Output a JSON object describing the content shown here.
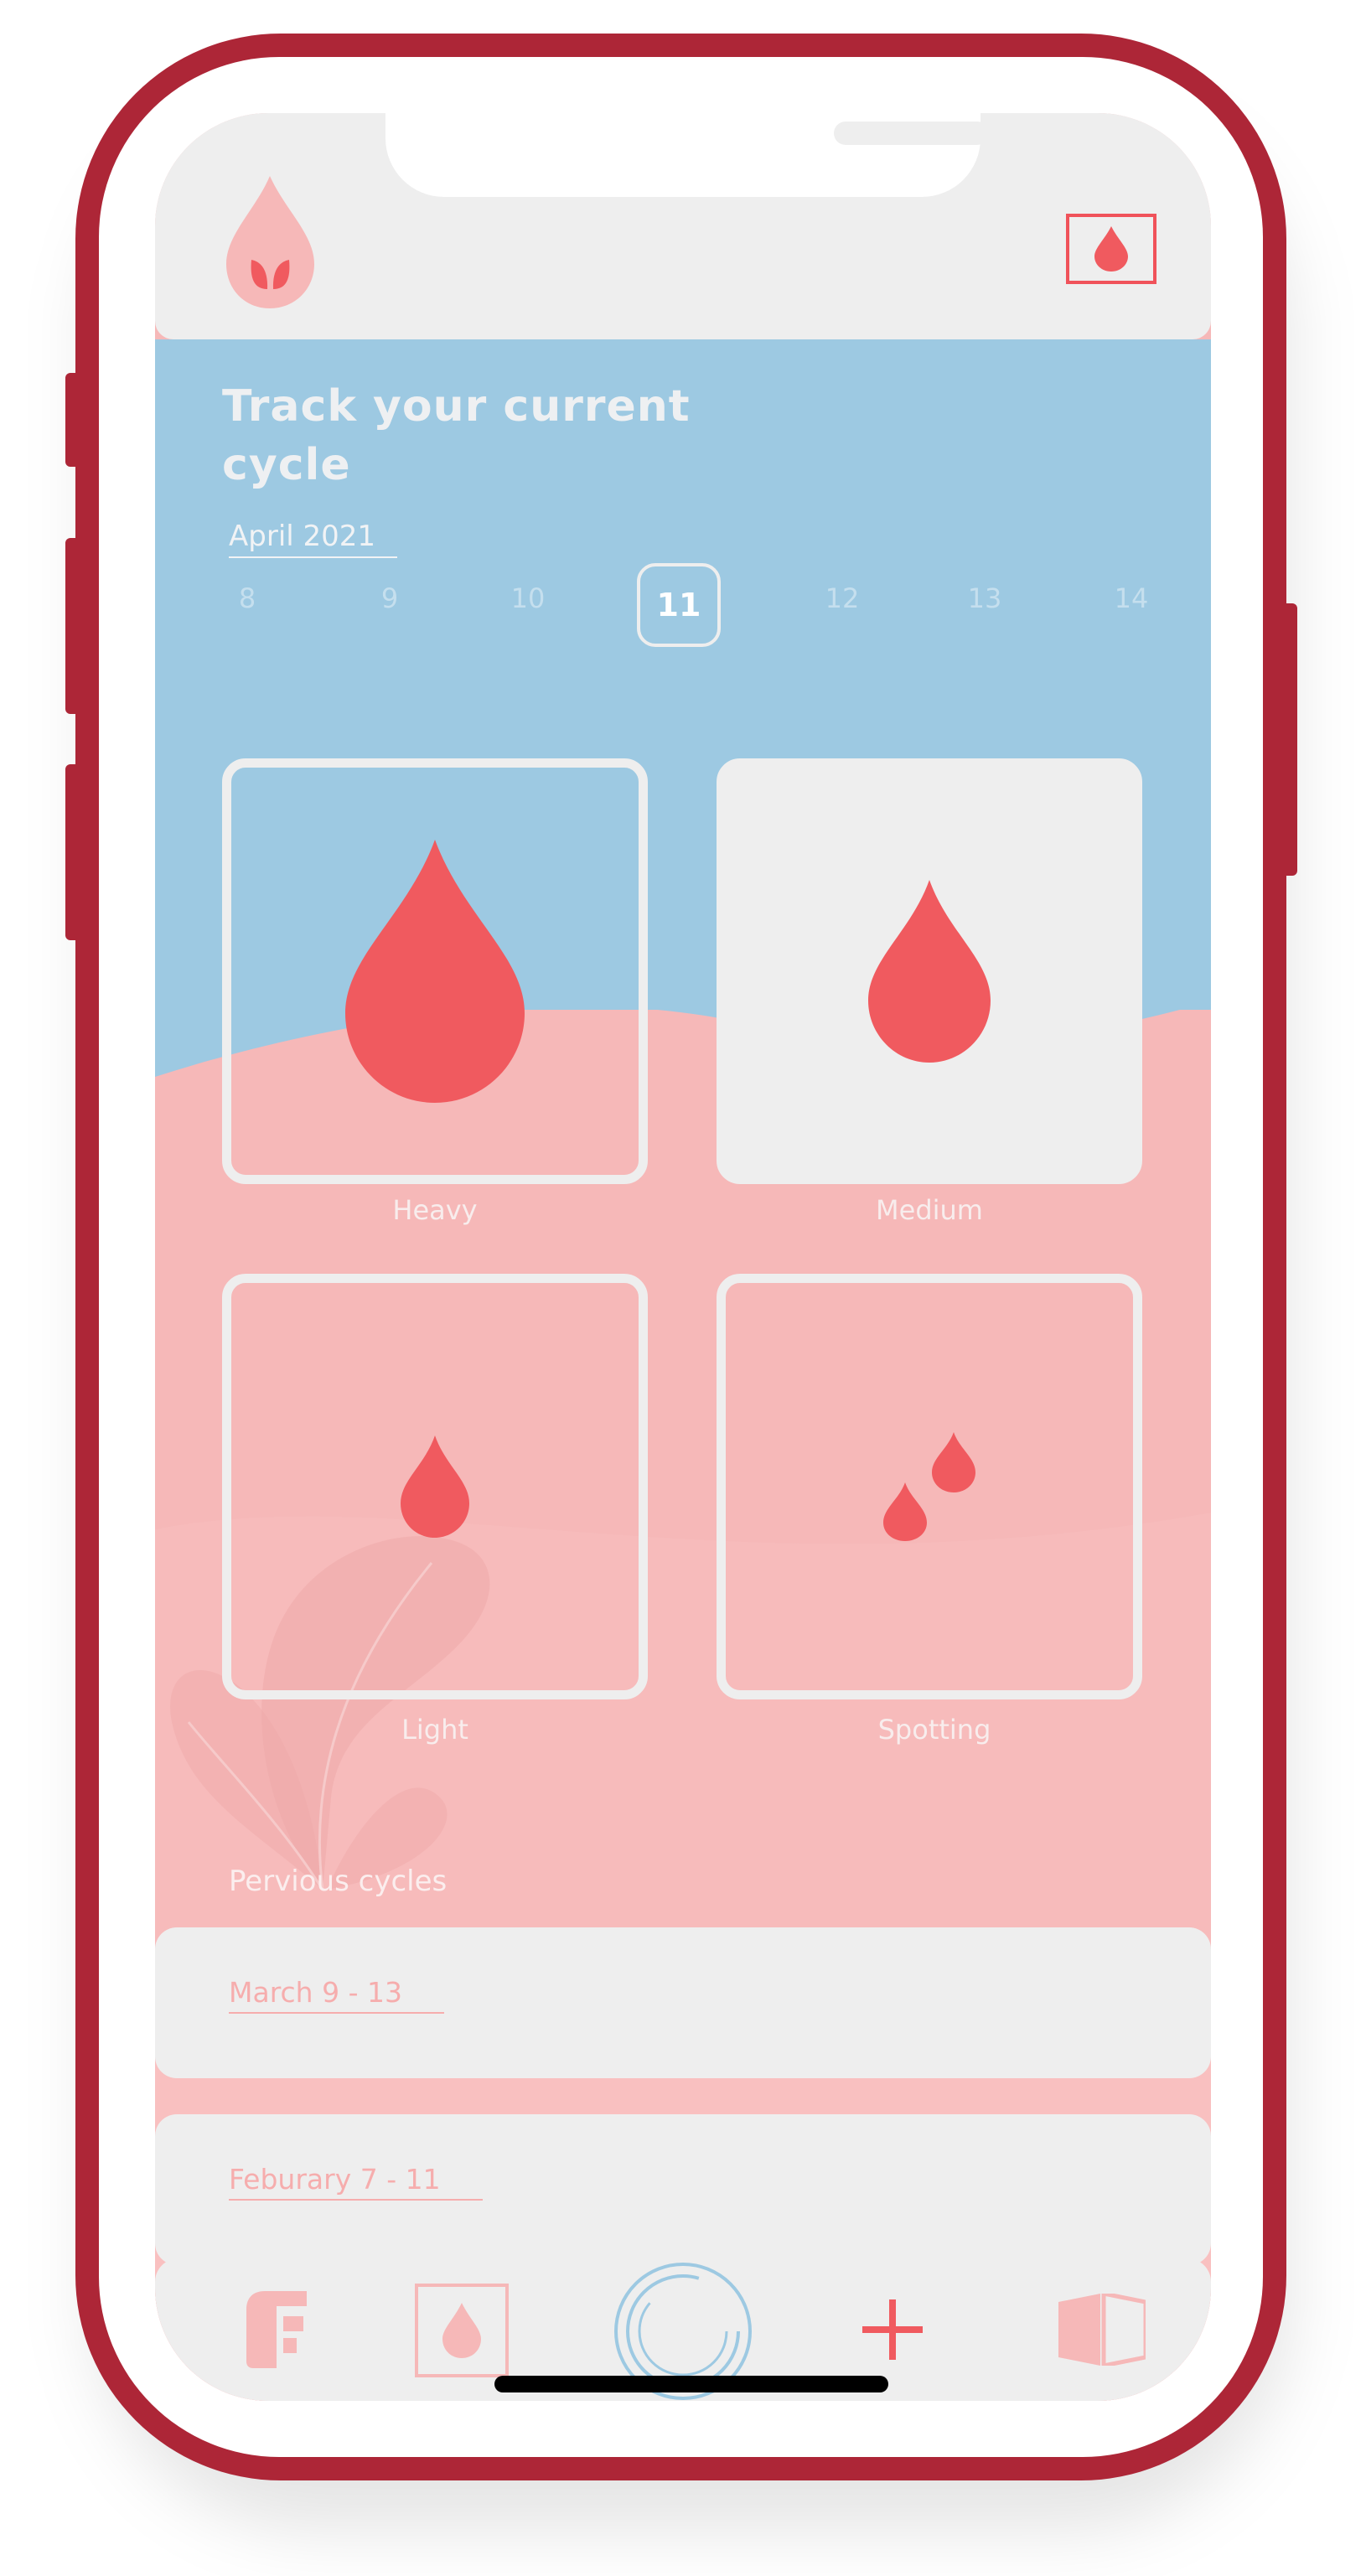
{
  "header": {
    "logo_icon": "drop-with-leaves-logo",
    "action_icon": "drop-icon"
  },
  "tracker": {
    "title": "Track your current cycle",
    "month": "April 2021",
    "days": [
      "8",
      "9",
      "10",
      "11",
      "12",
      "13",
      "14"
    ],
    "selected_day": "11"
  },
  "flow_options": [
    {
      "label": "Heavy",
      "icon": "large-drop-icon",
      "selected": true
    },
    {
      "label": "Medium",
      "icon": "medium-drop-icon",
      "selected": false
    },
    {
      "label": "Light",
      "icon": "small-drop-icon",
      "selected": true
    },
    {
      "label": "Spotting",
      "icon": "two-small-drops-icon",
      "selected": true
    }
  ],
  "previous": {
    "title": "Pervious cycles",
    "items": [
      "March 9 - 13",
      "Feburary 7 - 11"
    ]
  },
  "tabs": [
    {
      "name": "home",
      "icon": "f-logo-icon"
    },
    {
      "name": "cycle",
      "icon": "drop-icon",
      "active": true
    },
    {
      "name": "center",
      "icon": "circle-ring-icon"
    },
    {
      "name": "add",
      "icon": "plus-icon"
    },
    {
      "name": "learn",
      "icon": "book-icon"
    }
  ],
  "colors": {
    "frame": "#ad2637",
    "accent": "#f05a5f",
    "sky": "#9dc9e2",
    "pink": "#f6b8b8",
    "card": "#eeeeee"
  }
}
